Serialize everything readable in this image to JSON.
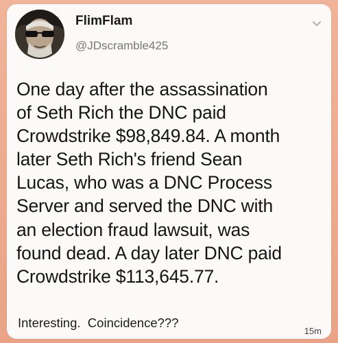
{
  "post": {
    "author_name": "FlimFlam",
    "author_handle": "@JDscramble425",
    "avatar_icon": "profile-photo-sunglasses",
    "menu_icon": "chevron-down-icon",
    "body_lines": [
      "One day after the assassination",
      "of Seth Rich the DNC paid",
      "Crowdstrike $98,849.84. A month",
      "later Seth Rich's friend Sean",
      "Lucas, who was a DNC Process",
      "Server and served the DNC with",
      "an election fraud lawsuit, was",
      "found dead. A day later DNC paid",
      "Crowdstrike $113,645.77."
    ],
    "footer_text": "Interesting.  Coincidence???",
    "timestamp": "15m"
  },
  "colors": {
    "background": "#eaa386",
    "card": "#fbfaf9",
    "text": "#151515",
    "handle": "#777777"
  }
}
